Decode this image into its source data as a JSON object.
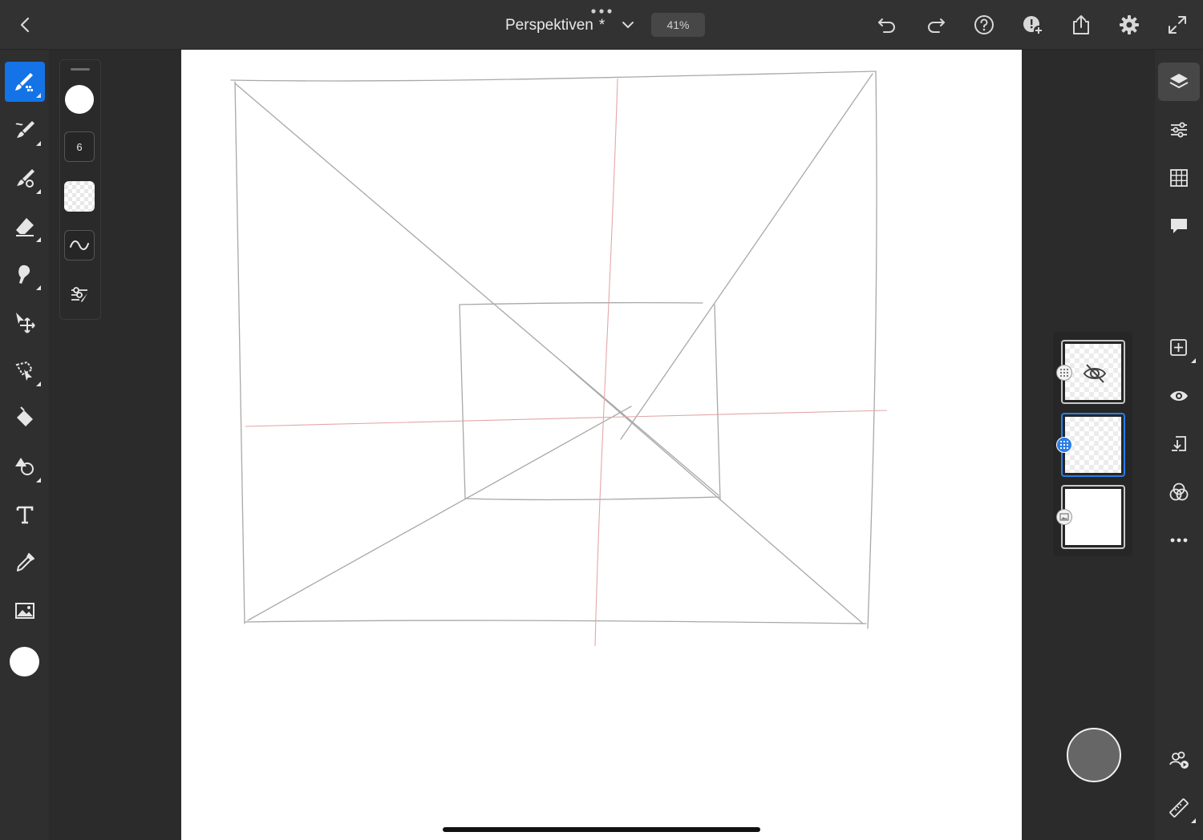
{
  "header": {
    "document_title": "Perspektiven",
    "unsaved_marker": "*",
    "zoom_level": "41%",
    "buttons": [
      "back",
      "more",
      "document-menu",
      "undo",
      "redo",
      "help",
      "learn",
      "share",
      "settings",
      "fullscreen"
    ]
  },
  "left_toolbar": {
    "tools": [
      "pixel-brush",
      "live-brush",
      "vector-brush",
      "eraser",
      "smudge",
      "transform",
      "selection",
      "fill",
      "shape",
      "text",
      "eyedropper",
      "place-image"
    ],
    "active_tool": "pixel-brush",
    "current_color": "#ffffff"
  },
  "brush_properties": {
    "size": "6",
    "brush_color": "#ffffff"
  },
  "right_toolbar": {
    "buttons": [
      "layers",
      "layer-properties",
      "grid",
      "comments",
      "add-layer",
      "visibility",
      "merge-down",
      "blend",
      "more"
    ],
    "active": "layers",
    "bottom_buttons": [
      "live-collaboration",
      "ruler"
    ]
  },
  "layers_panel": {
    "layers": [
      {
        "type": "pixel",
        "visible": false,
        "selected": false,
        "thumbnail": "transparent"
      },
      {
        "type": "pixel",
        "visible": true,
        "selected": true,
        "thumbnail": "transparent"
      },
      {
        "type": "image",
        "visible": true,
        "selected": false,
        "thumbnail": "white"
      }
    ]
  },
  "colors": {
    "accent": "#1473e6",
    "selection_blue": "#2b7de9",
    "sketch_line": "#9a9a9a",
    "horizon_line": "#e8a6a6"
  }
}
